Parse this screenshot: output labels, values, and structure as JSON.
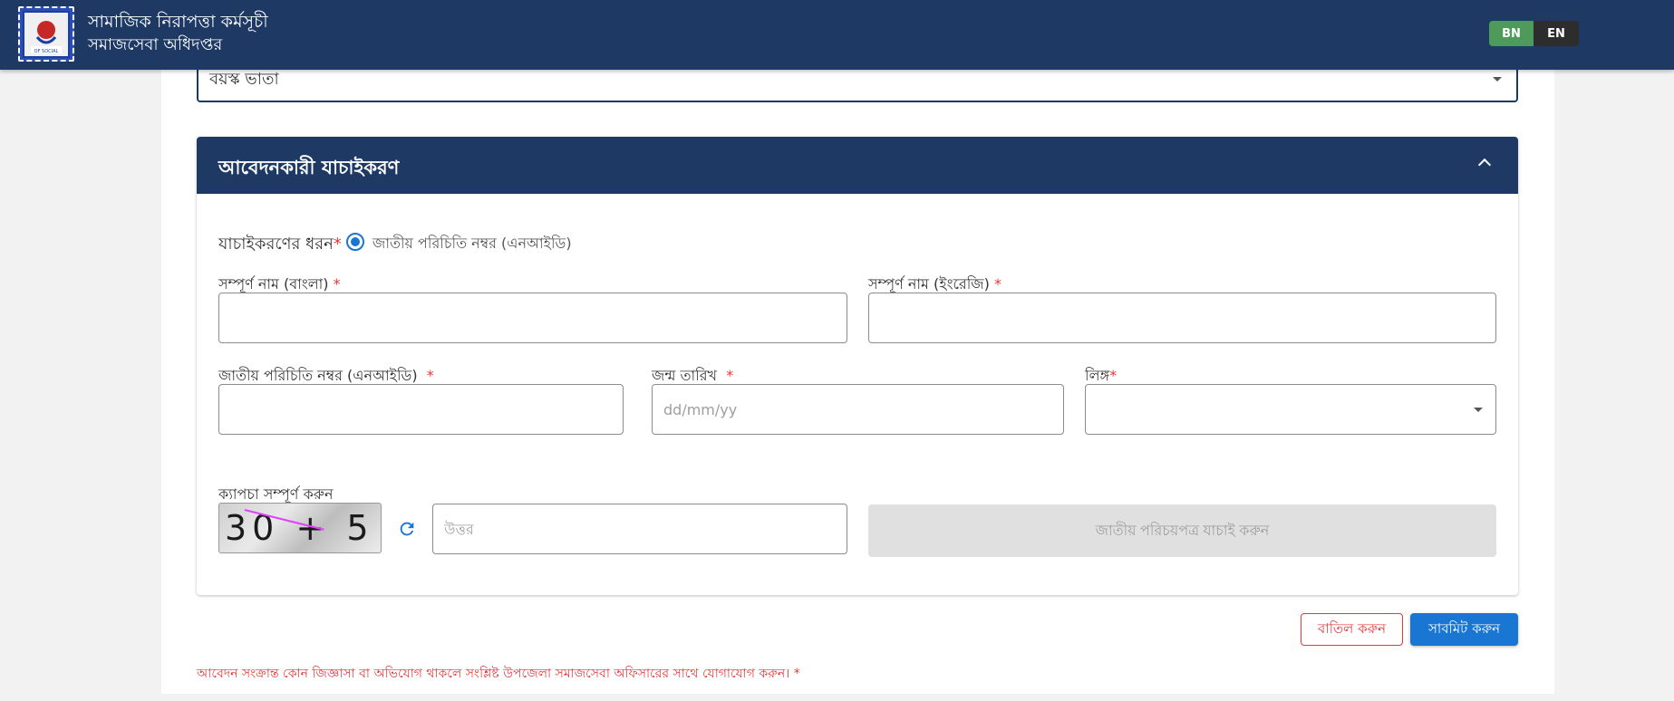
{
  "header": {
    "title_line1": "সামাজিক নিরাপত্তা কর্মসূচী",
    "title_line2": "সমাজসেবা অধিদপ্তর",
    "logo_text": "OF SOCIAL",
    "lang": {
      "bn": "BN",
      "en": "EN",
      "active": "BN"
    }
  },
  "program_select": {
    "value": "বয়স্ক ভাতা"
  },
  "section": {
    "title": "আবেদনকারী যাচাইকরণ",
    "verification_type": {
      "label": "যাচাইকরণের ধরন",
      "required_mark": "*",
      "option": "জাতীয় পরিচিতি নম্বর (এনআইডি)",
      "selected": true
    },
    "fields": {
      "full_name_bn": {
        "label": "সম্পূর্ণ নাম (বাংলা)",
        "required_mark": "*",
        "value": ""
      },
      "full_name_en": {
        "label": "সম্পূর্ণ নাম (ইংরেজি)",
        "required_mark": "*",
        "value": ""
      },
      "nid": {
        "label": "জাতীয় পরিচিতি নম্বর (এনআইডি)",
        "required_mark": "*",
        "value": ""
      },
      "dob": {
        "label": "জন্ম তারিখ",
        "required_mark": "*",
        "placeholder": "dd/mm/yy",
        "value": ""
      },
      "gender": {
        "label": "লিঙ্গ",
        "required_mark": "*",
        "value": ""
      }
    },
    "captcha": {
      "label": "ক্যাপচা সম্পূর্ণ করুন",
      "image_text": "30 + 5 =",
      "answer_placeholder": "উত্তর"
    },
    "verify_button": "জাতীয় পরিচয়পত্র যাচাই করুন"
  },
  "actions": {
    "cancel": "বাতিল করুন",
    "submit": "সাবমিট করুন"
  },
  "footer_note": "আবেদন সংক্রান্ত কোন জিজ্ঞাসা বা অভিযোগ থাকলে সংশ্লিষ্ট উপজেলা সমাজসেবা অফিসারের সাথে যোগাযোগ করুন। *",
  "colors": {
    "header_bg": "#1e3a64",
    "lang_active": "#4e9a5a",
    "primary": "#1976d2",
    "danger": "#e53935"
  }
}
